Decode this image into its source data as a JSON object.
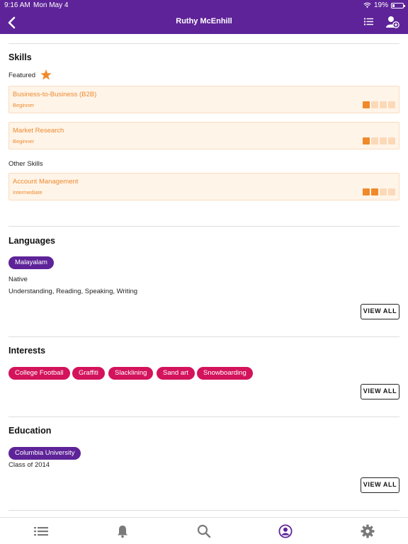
{
  "status_bar": {
    "time": "9:16 AM",
    "date": "Mon May 4",
    "battery": "19%"
  },
  "header": {
    "title": "Ruthy McEnhill"
  },
  "skills": {
    "title": "Skills",
    "featured_label": "Featured",
    "featured": [
      {
        "name": "Business-to-Business (B2B)",
        "level": "Beginner",
        "bars": [
          1,
          0,
          0,
          0
        ]
      },
      {
        "name": "Market Research",
        "level": "Beginner",
        "bars": [
          1,
          0,
          0,
          0
        ]
      }
    ],
    "other_label": "Other Skills",
    "other": [
      {
        "name": "Account Management",
        "level": "Intermediate",
        "bars": [
          1,
          1,
          0,
          0
        ]
      }
    ]
  },
  "languages": {
    "title": "Languages",
    "language": "Malayalam",
    "proficiency": "Native",
    "abilities": "Understanding, Reading, Speaking, Writing",
    "view_all": "VIEW ALL"
  },
  "interests": {
    "title": "Interests",
    "items": [
      "College Football",
      "Graffiti",
      "Slacklining",
      "Sand art",
      "Snowboarding"
    ],
    "view_all": "VIEW ALL"
  },
  "education": {
    "title": "Education",
    "school": "Columbia University",
    "class_of": "Class of 2014",
    "view_all": "VIEW ALL"
  },
  "colors": {
    "brand_purple": "#5e2398",
    "interest_pink": "#d3135c",
    "skill_orange": "#f0892a"
  },
  "tab_bar": {
    "icons": [
      "list-icon",
      "bell-icon",
      "search-icon",
      "profile-icon",
      "gear-icon"
    ],
    "active": "profile-icon"
  }
}
